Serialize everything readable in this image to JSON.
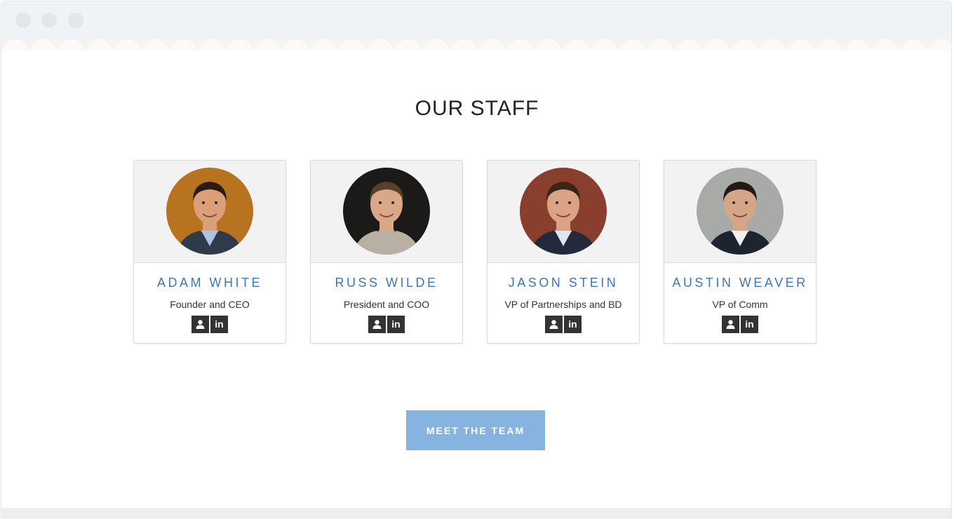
{
  "section": {
    "title": "OUR STAFF"
  },
  "staff": [
    {
      "name": "ADAM WHITE",
      "role": "Founder and CEO",
      "photo_bg": "#b7731f",
      "shirt": "#a9c6e6",
      "jacket": "#2f3b4a",
      "hair": "#2a1c12",
      "skin": "#d9a07a"
    },
    {
      "name": "RUSS WILDE",
      "role": "President and COO",
      "photo_bg": "#1b1a18",
      "shirt": "#b9b0a4",
      "jacket": "#b9b0a4",
      "hair": "#5a4028",
      "skin": "#d8a888"
    },
    {
      "name": "JASON STEIN",
      "role": "VP of Partnerships and BD",
      "photo_bg": "#8a3e2e",
      "shirt": "#dfe6f2",
      "jacket": "#242a3c",
      "hair": "#3a2616",
      "skin": "#dba386"
    },
    {
      "name": "AUSTIN WEAVER",
      "role": "VP of Comm",
      "photo_bg": "#a8aaa8",
      "shirt": "#f0f0f0",
      "jacket": "#1e2330",
      "hair": "#231a14",
      "skin": "#d4a688"
    }
  ],
  "icons": {
    "profile": "user-icon",
    "linkedin": "linkedin-icon",
    "linkedin_text": "in"
  },
  "cta": {
    "label": "MEET THE TEAM"
  },
  "colors": {
    "accent": "#3a78b5",
    "button": "#86b3e0",
    "icon_bg": "#333333"
  }
}
